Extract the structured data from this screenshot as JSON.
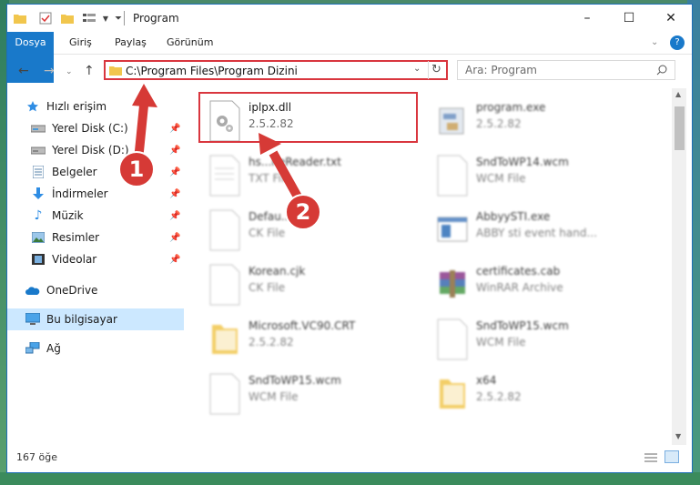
{
  "window": {
    "title": "Program",
    "minimize_glyph": "–",
    "maximize_glyph": "☐",
    "close_glyph": "✕"
  },
  "ribbon": {
    "tabs": [
      "Dosya",
      "Giriş",
      "Paylaş",
      "Görünüm"
    ],
    "file_tab_color": "#1979ca"
  },
  "address": {
    "path": "C:\\Program Files\\Program Dizini",
    "search_placeholder": "Ara: Program"
  },
  "sidebar": {
    "items": [
      {
        "label": "Hızlı erişim",
        "icon": "star-icon",
        "pinned": false
      },
      {
        "label": "Yerel Disk (C:)",
        "icon": "drive-icon",
        "pinned": true
      },
      {
        "label": "Yerel Disk (D:)",
        "icon": "drive-icon",
        "pinned": true
      },
      {
        "label": "Belgeler",
        "icon": "documents-icon",
        "pinned": true
      },
      {
        "label": "İndirmeler",
        "icon": "download-icon",
        "pinned": true
      },
      {
        "label": "Müzik",
        "icon": "music-icon",
        "pinned": true
      },
      {
        "label": "Resimler",
        "icon": "pictures-icon",
        "pinned": true
      },
      {
        "label": "Videolar",
        "icon": "video-icon",
        "pinned": true
      },
      {
        "label": "OneDrive",
        "icon": "cloud-icon",
        "pinned": false
      },
      {
        "label": "Bu bilgisayar",
        "icon": "computer-icon",
        "pinned": false,
        "selected": true
      },
      {
        "label": "Ağ",
        "icon": "network-icon",
        "pinned": false
      }
    ]
  },
  "files": [
    {
      "name": "iplpx.dll",
      "sub": "2.5.2.82",
      "icon": "dll-icon",
      "highlighted": true
    },
    {
      "name": "program.exe",
      "sub": "2.5.2.82",
      "icon": "exe-icon"
    },
    {
      "name": "hs...neReader.txt",
      "sub": "TXT File",
      "icon": "text-file-icon"
    },
    {
      "name": "SndToWP14.wcm",
      "sub": "WCM File",
      "icon": "blank-file-icon"
    },
    {
      "name": "Defau...jk",
      "sub": "CK File",
      "icon": "blank-file-icon"
    },
    {
      "name": "AbbyySTI.exe",
      "sub": "ABBY sti event hand...",
      "icon": "app-window-icon"
    },
    {
      "name": "Korean.cjk",
      "sub": "CK File",
      "icon": "blank-file-icon"
    },
    {
      "name": "certificates.cab",
      "sub": "WinRAR Archive",
      "icon": "archive-icon"
    },
    {
      "name": "Microsoft.VC90.CRT",
      "sub": "2.5.2.82",
      "icon": "folder-icon"
    },
    {
      "name": "SndToWP15.wcm",
      "sub": "WCM File",
      "icon": "blank-file-icon"
    },
    {
      "name": "SndToWP15.wcm",
      "sub": "WCM File",
      "icon": "blank-file-icon"
    },
    {
      "name": "x64",
      "sub": "2.5.2.82",
      "icon": "folder-icon"
    }
  ],
  "status": {
    "count": "167 öğe"
  },
  "annotations": {
    "step1": "1",
    "step2": "2",
    "color": "#d63a36"
  }
}
